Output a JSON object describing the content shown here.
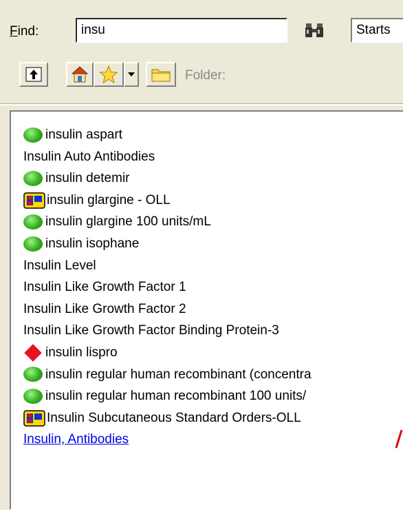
{
  "find": {
    "label": "Find:",
    "value": "insu",
    "search_mode": "Starts"
  },
  "toolbar": {
    "folder_label": "Folder:"
  },
  "results": [
    {
      "text": "insulin aspart",
      "icon": "green-circle-icon"
    },
    {
      "text": "Insulin Auto Antibodies",
      "icon": ""
    },
    {
      "text": "insulin detemir",
      "icon": "green-circle-icon"
    },
    {
      "text": "insulin glargine - OLL",
      "icon": "order-set-icon"
    },
    {
      "text": "insulin glargine 100 units/mL",
      "icon": "green-circle-icon"
    },
    {
      "text": "insulin isophane",
      "icon": "green-circle-icon"
    },
    {
      "text": "Insulin Level",
      "icon": ""
    },
    {
      "text": "Insulin Like Growth Factor 1",
      "icon": ""
    },
    {
      "text": "Insulin Like Growth Factor 2",
      "icon": ""
    },
    {
      "text": "Insulin Like Growth Factor Binding Protein-3",
      "icon": ""
    },
    {
      "text": "insulin lispro",
      "icon": "red-diamond-icon"
    },
    {
      "text": "insulin regular human recombinant (concentra",
      "icon": "green-circle-icon"
    },
    {
      "text": "insulin regular human recombinant 100 units/",
      "icon": "green-circle-icon"
    },
    {
      "text": "Insulin Subcutaneous Standard Orders-OLL",
      "icon": "order-set-icon"
    },
    {
      "text": "Insulin, Antibodies",
      "icon": "",
      "link": true
    }
  ],
  "colors": {
    "background": "#ece9d8",
    "link": "#0000ee",
    "green_icon": "#33b01d",
    "red_icon": "#e8121c"
  }
}
